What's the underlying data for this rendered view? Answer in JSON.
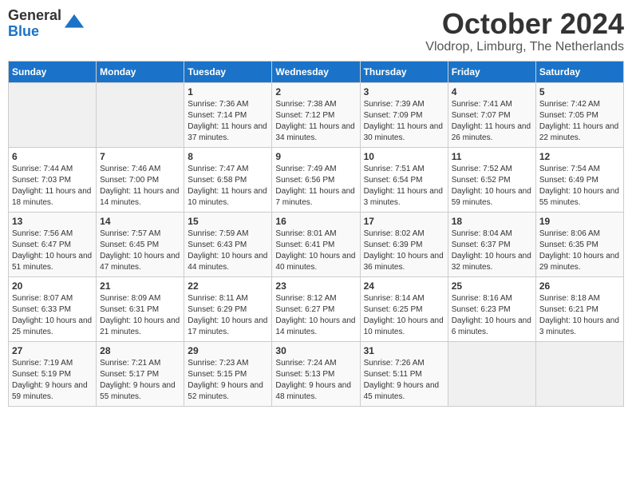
{
  "header": {
    "logo_general": "General",
    "logo_blue": "Blue",
    "month_title": "October 2024",
    "location": "Vlodrop, Limburg, The Netherlands"
  },
  "days_of_week": [
    "Sunday",
    "Monday",
    "Tuesday",
    "Wednesday",
    "Thursday",
    "Friday",
    "Saturday"
  ],
  "weeks": [
    [
      {
        "day": "",
        "empty": true
      },
      {
        "day": "",
        "empty": true
      },
      {
        "day": "1",
        "sunrise": "Sunrise: 7:36 AM",
        "sunset": "Sunset: 7:14 PM",
        "daylight": "Daylight: 11 hours and 37 minutes."
      },
      {
        "day": "2",
        "sunrise": "Sunrise: 7:38 AM",
        "sunset": "Sunset: 7:12 PM",
        "daylight": "Daylight: 11 hours and 34 minutes."
      },
      {
        "day": "3",
        "sunrise": "Sunrise: 7:39 AM",
        "sunset": "Sunset: 7:09 PM",
        "daylight": "Daylight: 11 hours and 30 minutes."
      },
      {
        "day": "4",
        "sunrise": "Sunrise: 7:41 AM",
        "sunset": "Sunset: 7:07 PM",
        "daylight": "Daylight: 11 hours and 26 minutes."
      },
      {
        "day": "5",
        "sunrise": "Sunrise: 7:42 AM",
        "sunset": "Sunset: 7:05 PM",
        "daylight": "Daylight: 11 hours and 22 minutes."
      }
    ],
    [
      {
        "day": "6",
        "sunrise": "Sunrise: 7:44 AM",
        "sunset": "Sunset: 7:03 PM",
        "daylight": "Daylight: 11 hours and 18 minutes."
      },
      {
        "day": "7",
        "sunrise": "Sunrise: 7:46 AM",
        "sunset": "Sunset: 7:00 PM",
        "daylight": "Daylight: 11 hours and 14 minutes."
      },
      {
        "day": "8",
        "sunrise": "Sunrise: 7:47 AM",
        "sunset": "Sunset: 6:58 PM",
        "daylight": "Daylight: 11 hours and 10 minutes."
      },
      {
        "day": "9",
        "sunrise": "Sunrise: 7:49 AM",
        "sunset": "Sunset: 6:56 PM",
        "daylight": "Daylight: 11 hours and 7 minutes."
      },
      {
        "day": "10",
        "sunrise": "Sunrise: 7:51 AM",
        "sunset": "Sunset: 6:54 PM",
        "daylight": "Daylight: 11 hours and 3 minutes."
      },
      {
        "day": "11",
        "sunrise": "Sunrise: 7:52 AM",
        "sunset": "Sunset: 6:52 PM",
        "daylight": "Daylight: 10 hours and 59 minutes."
      },
      {
        "day": "12",
        "sunrise": "Sunrise: 7:54 AM",
        "sunset": "Sunset: 6:49 PM",
        "daylight": "Daylight: 10 hours and 55 minutes."
      }
    ],
    [
      {
        "day": "13",
        "sunrise": "Sunrise: 7:56 AM",
        "sunset": "Sunset: 6:47 PM",
        "daylight": "Daylight: 10 hours and 51 minutes."
      },
      {
        "day": "14",
        "sunrise": "Sunrise: 7:57 AM",
        "sunset": "Sunset: 6:45 PM",
        "daylight": "Daylight: 10 hours and 47 minutes."
      },
      {
        "day": "15",
        "sunrise": "Sunrise: 7:59 AM",
        "sunset": "Sunset: 6:43 PM",
        "daylight": "Daylight: 10 hours and 44 minutes."
      },
      {
        "day": "16",
        "sunrise": "Sunrise: 8:01 AM",
        "sunset": "Sunset: 6:41 PM",
        "daylight": "Daylight: 10 hours and 40 minutes."
      },
      {
        "day": "17",
        "sunrise": "Sunrise: 8:02 AM",
        "sunset": "Sunset: 6:39 PM",
        "daylight": "Daylight: 10 hours and 36 minutes."
      },
      {
        "day": "18",
        "sunrise": "Sunrise: 8:04 AM",
        "sunset": "Sunset: 6:37 PM",
        "daylight": "Daylight: 10 hours and 32 minutes."
      },
      {
        "day": "19",
        "sunrise": "Sunrise: 8:06 AM",
        "sunset": "Sunset: 6:35 PM",
        "daylight": "Daylight: 10 hours and 29 minutes."
      }
    ],
    [
      {
        "day": "20",
        "sunrise": "Sunrise: 8:07 AM",
        "sunset": "Sunset: 6:33 PM",
        "daylight": "Daylight: 10 hours and 25 minutes."
      },
      {
        "day": "21",
        "sunrise": "Sunrise: 8:09 AM",
        "sunset": "Sunset: 6:31 PM",
        "daylight": "Daylight: 10 hours and 21 minutes."
      },
      {
        "day": "22",
        "sunrise": "Sunrise: 8:11 AM",
        "sunset": "Sunset: 6:29 PM",
        "daylight": "Daylight: 10 hours and 17 minutes."
      },
      {
        "day": "23",
        "sunrise": "Sunrise: 8:12 AM",
        "sunset": "Sunset: 6:27 PM",
        "daylight": "Daylight: 10 hours and 14 minutes."
      },
      {
        "day": "24",
        "sunrise": "Sunrise: 8:14 AM",
        "sunset": "Sunset: 6:25 PM",
        "daylight": "Daylight: 10 hours and 10 minutes."
      },
      {
        "day": "25",
        "sunrise": "Sunrise: 8:16 AM",
        "sunset": "Sunset: 6:23 PM",
        "daylight": "Daylight: 10 hours and 6 minutes."
      },
      {
        "day": "26",
        "sunrise": "Sunrise: 8:18 AM",
        "sunset": "Sunset: 6:21 PM",
        "daylight": "Daylight: 10 hours and 3 minutes."
      }
    ],
    [
      {
        "day": "27",
        "sunrise": "Sunrise: 7:19 AM",
        "sunset": "Sunset: 5:19 PM",
        "daylight": "Daylight: 9 hours and 59 minutes."
      },
      {
        "day": "28",
        "sunrise": "Sunrise: 7:21 AM",
        "sunset": "Sunset: 5:17 PM",
        "daylight": "Daylight: 9 hours and 55 minutes."
      },
      {
        "day": "29",
        "sunrise": "Sunrise: 7:23 AM",
        "sunset": "Sunset: 5:15 PM",
        "daylight": "Daylight: 9 hours and 52 minutes."
      },
      {
        "day": "30",
        "sunrise": "Sunrise: 7:24 AM",
        "sunset": "Sunset: 5:13 PM",
        "daylight": "Daylight: 9 hours and 48 minutes."
      },
      {
        "day": "31",
        "sunrise": "Sunrise: 7:26 AM",
        "sunset": "Sunset: 5:11 PM",
        "daylight": "Daylight: 9 hours and 45 minutes."
      },
      {
        "day": "",
        "empty": true
      },
      {
        "day": "",
        "empty": true
      }
    ]
  ]
}
